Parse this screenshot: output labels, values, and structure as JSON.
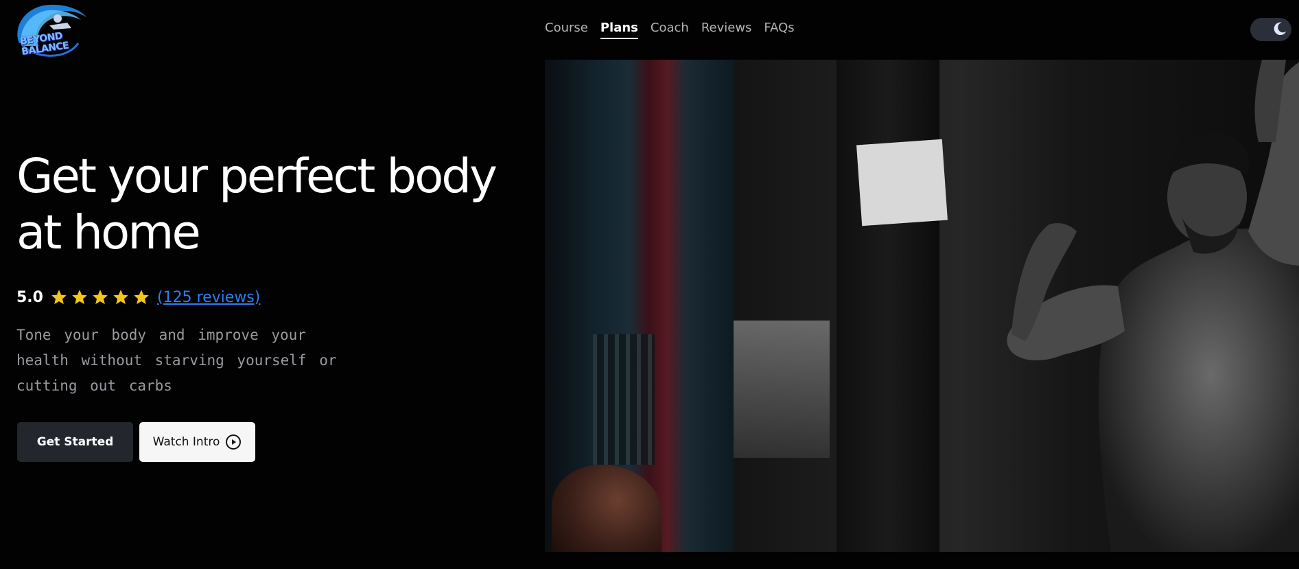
{
  "brand": {
    "logo_text": "BEYOND BALANCE"
  },
  "nav": {
    "items": [
      {
        "label": "Course",
        "active": false
      },
      {
        "label": "Plans",
        "active": true
      },
      {
        "label": "Coach",
        "active": false
      },
      {
        "label": "Reviews",
        "active": false
      },
      {
        "label": "FAQs",
        "active": false
      }
    ]
  },
  "theme_toggle": {
    "icon": "moon-icon",
    "state": "dark"
  },
  "hero": {
    "title": "Get your perfect body at home",
    "rating": {
      "value": "5.0",
      "stars": 5,
      "reviews_link": "(125 reviews)"
    },
    "subtitle": "Tone your body and improve your health without starving yourself or cutting out carbs",
    "primary_button": "Get Started",
    "secondary_button": "Watch Intro"
  },
  "colors": {
    "background": "#020203",
    "star": "#f5c518",
    "link": "#2f7cf6",
    "primary_button_bg": "#23262d",
    "secondary_button_bg": "#f6f6f7"
  }
}
